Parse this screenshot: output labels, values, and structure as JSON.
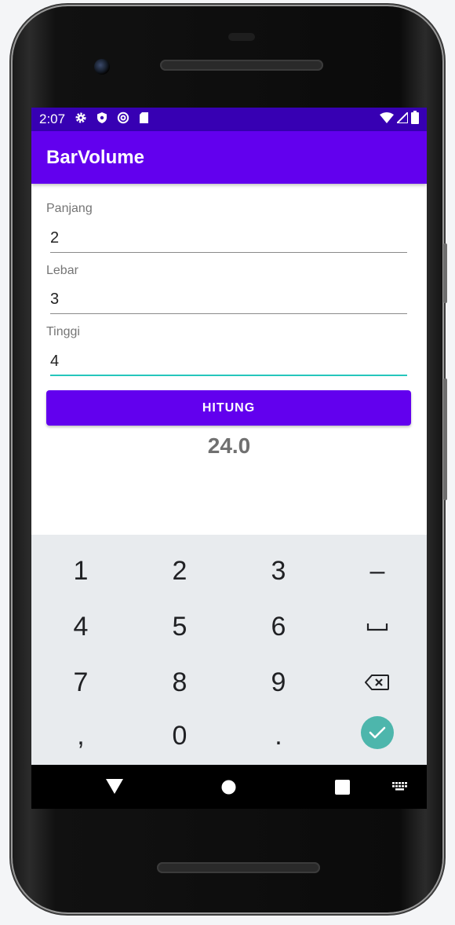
{
  "statusbar": {
    "time": "2:07",
    "icons": [
      "gear-icon",
      "shield-icon",
      "at-sign-icon",
      "sd-card-icon"
    ],
    "right_icons": [
      "wifi-icon",
      "signal-icon",
      "battery-icon"
    ]
  },
  "appbar": {
    "title": "BarVolume"
  },
  "form": {
    "panjang": {
      "label": "Panjang",
      "value": "2"
    },
    "lebar": {
      "label": "Lebar",
      "value": "3"
    },
    "tinggi": {
      "label": "Tinggi",
      "value": "4"
    }
  },
  "button": {
    "label": "HITUNG"
  },
  "result": {
    "text": "24.0"
  },
  "keyboard": {
    "keys": [
      "1",
      "2",
      "3",
      "–",
      "4",
      "5",
      "6",
      "7",
      "8",
      "9",
      ",",
      "0",
      "."
    ],
    "special": [
      "space-key",
      "backspace-key",
      "done-key"
    ]
  },
  "colors": {
    "statusbar": "#3700b3",
    "primary": "#6200ee",
    "accent": "#26c6bc",
    "keyboard_bg": "#e8ebee",
    "done_key": "#4db6ac"
  },
  "navbar": {
    "icons": [
      "back-icon",
      "home-icon",
      "recents-icon",
      "keyboard-switch-icon"
    ]
  }
}
